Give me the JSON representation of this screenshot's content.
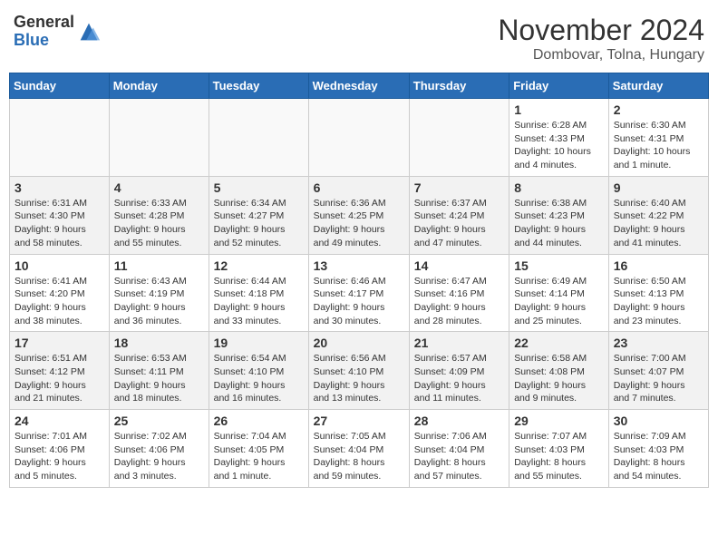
{
  "header": {
    "logo_general": "General",
    "logo_blue": "Blue",
    "month_title": "November 2024",
    "location": "Dombovar, Tolna, Hungary"
  },
  "days_of_week": [
    "Sunday",
    "Monday",
    "Tuesday",
    "Wednesday",
    "Thursday",
    "Friday",
    "Saturday"
  ],
  "weeks": [
    [
      {
        "day": "",
        "info": ""
      },
      {
        "day": "",
        "info": ""
      },
      {
        "day": "",
        "info": ""
      },
      {
        "day": "",
        "info": ""
      },
      {
        "day": "",
        "info": ""
      },
      {
        "day": "1",
        "info": "Sunrise: 6:28 AM\nSunset: 4:33 PM\nDaylight: 10 hours\nand 4 minutes."
      },
      {
        "day": "2",
        "info": "Sunrise: 6:30 AM\nSunset: 4:31 PM\nDaylight: 10 hours\nand 1 minute."
      }
    ],
    [
      {
        "day": "3",
        "info": "Sunrise: 6:31 AM\nSunset: 4:30 PM\nDaylight: 9 hours\nand 58 minutes."
      },
      {
        "day": "4",
        "info": "Sunrise: 6:33 AM\nSunset: 4:28 PM\nDaylight: 9 hours\nand 55 minutes."
      },
      {
        "day": "5",
        "info": "Sunrise: 6:34 AM\nSunset: 4:27 PM\nDaylight: 9 hours\nand 52 minutes."
      },
      {
        "day": "6",
        "info": "Sunrise: 6:36 AM\nSunset: 4:25 PM\nDaylight: 9 hours\nand 49 minutes."
      },
      {
        "day": "7",
        "info": "Sunrise: 6:37 AM\nSunset: 4:24 PM\nDaylight: 9 hours\nand 47 minutes."
      },
      {
        "day": "8",
        "info": "Sunrise: 6:38 AM\nSunset: 4:23 PM\nDaylight: 9 hours\nand 44 minutes."
      },
      {
        "day": "9",
        "info": "Sunrise: 6:40 AM\nSunset: 4:22 PM\nDaylight: 9 hours\nand 41 minutes."
      }
    ],
    [
      {
        "day": "10",
        "info": "Sunrise: 6:41 AM\nSunset: 4:20 PM\nDaylight: 9 hours\nand 38 minutes."
      },
      {
        "day": "11",
        "info": "Sunrise: 6:43 AM\nSunset: 4:19 PM\nDaylight: 9 hours\nand 36 minutes."
      },
      {
        "day": "12",
        "info": "Sunrise: 6:44 AM\nSunset: 4:18 PM\nDaylight: 9 hours\nand 33 minutes."
      },
      {
        "day": "13",
        "info": "Sunrise: 6:46 AM\nSunset: 4:17 PM\nDaylight: 9 hours\nand 30 minutes."
      },
      {
        "day": "14",
        "info": "Sunrise: 6:47 AM\nSunset: 4:16 PM\nDaylight: 9 hours\nand 28 minutes."
      },
      {
        "day": "15",
        "info": "Sunrise: 6:49 AM\nSunset: 4:14 PM\nDaylight: 9 hours\nand 25 minutes."
      },
      {
        "day": "16",
        "info": "Sunrise: 6:50 AM\nSunset: 4:13 PM\nDaylight: 9 hours\nand 23 minutes."
      }
    ],
    [
      {
        "day": "17",
        "info": "Sunrise: 6:51 AM\nSunset: 4:12 PM\nDaylight: 9 hours\nand 21 minutes."
      },
      {
        "day": "18",
        "info": "Sunrise: 6:53 AM\nSunset: 4:11 PM\nDaylight: 9 hours\nand 18 minutes."
      },
      {
        "day": "19",
        "info": "Sunrise: 6:54 AM\nSunset: 4:10 PM\nDaylight: 9 hours\nand 16 minutes."
      },
      {
        "day": "20",
        "info": "Sunrise: 6:56 AM\nSunset: 4:10 PM\nDaylight: 9 hours\nand 13 minutes."
      },
      {
        "day": "21",
        "info": "Sunrise: 6:57 AM\nSunset: 4:09 PM\nDaylight: 9 hours\nand 11 minutes."
      },
      {
        "day": "22",
        "info": "Sunrise: 6:58 AM\nSunset: 4:08 PM\nDaylight: 9 hours\nand 9 minutes."
      },
      {
        "day": "23",
        "info": "Sunrise: 7:00 AM\nSunset: 4:07 PM\nDaylight: 9 hours\nand 7 minutes."
      }
    ],
    [
      {
        "day": "24",
        "info": "Sunrise: 7:01 AM\nSunset: 4:06 PM\nDaylight: 9 hours\nand 5 minutes."
      },
      {
        "day": "25",
        "info": "Sunrise: 7:02 AM\nSunset: 4:06 PM\nDaylight: 9 hours\nand 3 minutes."
      },
      {
        "day": "26",
        "info": "Sunrise: 7:04 AM\nSunset: 4:05 PM\nDaylight: 9 hours\nand 1 minute."
      },
      {
        "day": "27",
        "info": "Sunrise: 7:05 AM\nSunset: 4:04 PM\nDaylight: 8 hours\nand 59 minutes."
      },
      {
        "day": "28",
        "info": "Sunrise: 7:06 AM\nSunset: 4:04 PM\nDaylight: 8 hours\nand 57 minutes."
      },
      {
        "day": "29",
        "info": "Sunrise: 7:07 AM\nSunset: 4:03 PM\nDaylight: 8 hours\nand 55 minutes."
      },
      {
        "day": "30",
        "info": "Sunrise: 7:09 AM\nSunset: 4:03 PM\nDaylight: 8 hours\nand 54 minutes."
      }
    ]
  ]
}
